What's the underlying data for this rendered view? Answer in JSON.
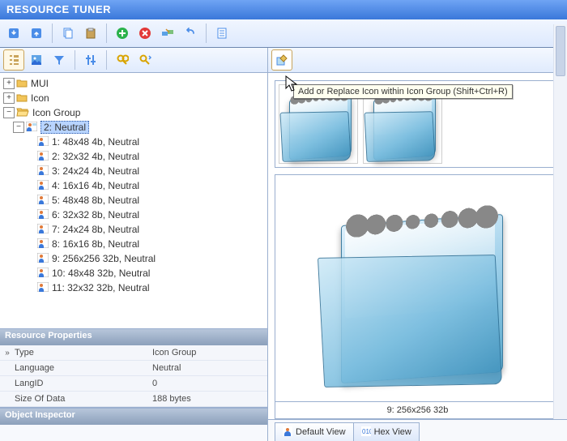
{
  "title": "RESOURCE TUNER",
  "tooltip": "Add or Replace Icon within Icon Group (Shift+Ctrl+R)",
  "toolbar": {
    "down": "down-arrow",
    "up": "up-arrow",
    "copy": "copy",
    "paste": "paste",
    "add": "add",
    "delete": "delete",
    "rename": "rename",
    "undo": "undo",
    "options": "options"
  },
  "left_toolbar": {
    "tree_view": "tree",
    "image_view": "image",
    "filter": "filter",
    "settings": "settings",
    "find": "find",
    "find_next": "find-next"
  },
  "tree": {
    "roots": [
      {
        "expanded": true,
        "label": "MUI",
        "icon": "folder"
      },
      {
        "expanded": true,
        "label": "Icon",
        "icon": "folder"
      },
      {
        "expanded": false,
        "label": "Icon Group",
        "icon": "folder-open",
        "children": [
          {
            "expanded": false,
            "label": "2: Neutral",
            "icon": "group",
            "selected": true,
            "children": [
              {
                "label": "1: 48x48 4b, Neutral",
                "icon": "img"
              },
              {
                "label": "2: 32x32 4b, Neutral",
                "icon": "img"
              },
              {
                "label": "3: 24x24 4b, Neutral",
                "icon": "img"
              },
              {
                "label": "4: 16x16 4b, Neutral",
                "icon": "img"
              },
              {
                "label": "5: 48x48 8b, Neutral",
                "icon": "img"
              },
              {
                "label": "6: 32x32 8b, Neutral",
                "icon": "img"
              },
              {
                "label": "7: 24x24 8b, Neutral",
                "icon": "img"
              },
              {
                "label": "8: 16x16 8b, Neutral",
                "icon": "img"
              },
              {
                "label": "9: 256x256 32b, Neutral",
                "icon": "img"
              },
              {
                "label": "10: 48x48 32b, Neutral",
                "icon": "img"
              },
              {
                "label": "11: 32x32 32b, Neutral",
                "icon": "img"
              }
            ]
          }
        ]
      }
    ]
  },
  "properties": {
    "title": "Resource Properties",
    "rows": [
      {
        "key": "Type",
        "val": "Icon Group",
        "chev": true
      },
      {
        "key": "Language",
        "val": "Neutral"
      },
      {
        "key": "LangID",
        "val": "0"
      },
      {
        "key": "Size Of Data",
        "val": "188 bytes"
      }
    ]
  },
  "object_inspector": {
    "title": "Object Inspector"
  },
  "right_toolbar": {
    "edit": "edit-icon"
  },
  "preview_caption": "9: 256x256 32b",
  "tabs": {
    "default": "Default View",
    "hex": "Hex View"
  }
}
